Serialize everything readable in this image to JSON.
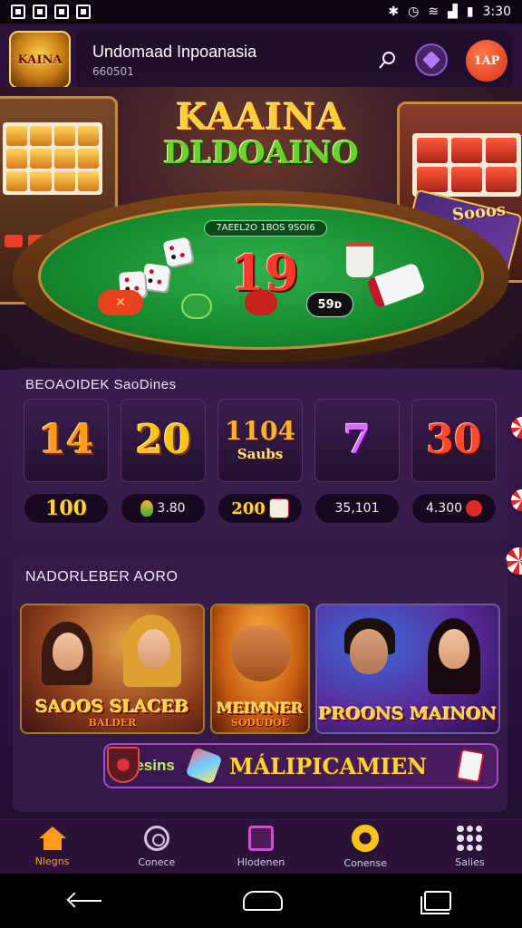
{
  "status_bar": {
    "time": "3:30"
  },
  "header": {
    "logo_text": "KAINA",
    "title": "Undomaad Inpoanasia",
    "subtitle": "660501",
    "badge_text": "1ΑΡ"
  },
  "hero": {
    "title_line1": "KAAINA",
    "title_line2": "DLDOAINO",
    "felt_label": "7AEEL2O 1BOS 9SOI6",
    "slot_label": "Sooos",
    "center_number": "19",
    "chip_label": "59ᴅ"
  },
  "bets_section": {
    "title": "BEOAOIDEK SaoDines",
    "tiles": [
      {
        "number": "14",
        "sub": ""
      },
      {
        "number": "20",
        "sub": ""
      },
      {
        "number": "1104",
        "sub": "Saubs"
      },
      {
        "number": "7",
        "sub": ""
      },
      {
        "number": "30",
        "sub": ""
      }
    ],
    "pills": [
      {
        "value": "100"
      },
      {
        "value": "3.80"
      },
      {
        "value": "200"
      },
      {
        "value": "35,101"
      },
      {
        "value": "4.300"
      }
    ]
  },
  "games_section": {
    "title": "NADORLEBER AORO",
    "cards": [
      {
        "label": "SAOOS SLACEB",
        "sublabel": "BALDER"
      },
      {
        "label": "MEIMNER",
        "sublabel": "SODUDOE"
      },
      {
        "label": "PROONS MAINON",
        "sublabel": ""
      }
    ],
    "promo": {
      "left": "Sesins",
      "main": "MÁLIPICAMIEN"
    }
  },
  "bottom_nav": [
    {
      "label": "Nlegns",
      "icon": "home-icon"
    },
    {
      "label": "Conece",
      "icon": "chip-icon"
    },
    {
      "label": "Hlodenen",
      "icon": "cards-icon"
    },
    {
      "label": "Conense",
      "icon": "gear-icon"
    },
    {
      "label": "Saiies",
      "icon": "grid-icon"
    }
  ],
  "colors": {
    "accent": "#ffa21a",
    "background": "#2a1238",
    "felt": "#168a30"
  }
}
